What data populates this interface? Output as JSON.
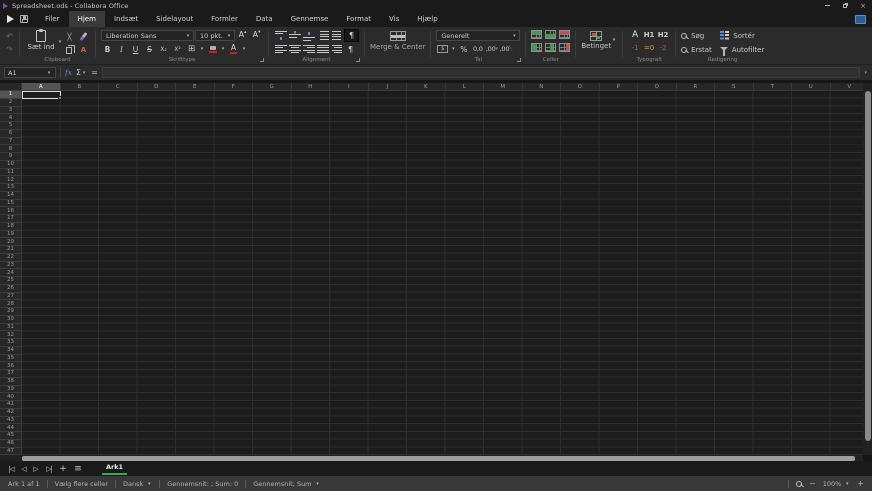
{
  "window": {
    "title": "Spreadsheet.ods - Collabora Office"
  },
  "menubar": {
    "tabs": [
      "Filer",
      "Hjem",
      "Indsæt",
      "Sidelayout",
      "Formler",
      "Data",
      "Gennemse",
      "Format",
      "Vis",
      "Hjælp"
    ],
    "active_tab": "Hjem"
  },
  "ribbon": {
    "groups": {
      "clipboard": {
        "label": "Clipboard",
        "paste": "Sæt ind"
      },
      "font": {
        "label": "Skrifttype",
        "font_name": "Liberation Sans",
        "font_size": "10 pkt.",
        "bold": "B",
        "italic": "I",
        "underline": "U",
        "strikethrough": "S",
        "subscript": "X₂",
        "superscript": "X²",
        "grow": "A",
        "shrink": "A"
      },
      "alignment": {
        "label": "Alignment"
      },
      "merge": {
        "label": "Merge & Center"
      },
      "number": {
        "label": "Tal",
        "format": "Generelt",
        "percent": "%",
        "number": "0,0",
        "add_decimal": ",00",
        "del_decimal": ",00"
      },
      "cells": {
        "label": "Celler"
      },
      "conditional": {
        "label": "Betinget"
      },
      "styles": {
        "label": "Typografi",
        "default_style": "A",
        "heading1": "H1",
        "heading2": "H2",
        "good": "-1",
        "neutral": "=0",
        "bad": "-2"
      },
      "editing": {
        "label": "Redigering",
        "search": "Søg",
        "replace": "Erstat",
        "sort": "Sortér",
        "autofilter": "Autofilter"
      }
    }
  },
  "formula_bar": {
    "cell_reference": "A1",
    "function_wizard": "fx",
    "sum": "Σ",
    "equals": "=",
    "formula": ""
  },
  "grid": {
    "columns": [
      "A",
      "B",
      "C",
      "D",
      "E",
      "F",
      "G",
      "H",
      "I",
      "J",
      "K",
      "L",
      "M",
      "N",
      "O",
      "P",
      "Q",
      "R",
      "S",
      "T",
      "U",
      "V"
    ],
    "row_count": 48,
    "selected_cell": "A1",
    "selected_column": "A",
    "selected_row": 1
  },
  "sheet_bar": {
    "tabs": [
      "Ark1"
    ],
    "active_tab": "Ark1"
  },
  "status_bar": {
    "sheet_position": "Ark 1 af 1",
    "selection_mode": "Vælg flere celler",
    "language": "Dansk",
    "stats": "Gennemsnit: ; Sum: 0",
    "stats_selector": "Gennemsnit; Sum",
    "zoom_out": "−",
    "zoom_level": "100%",
    "zoom_in": "+"
  },
  "icons": {
    "dropdown": "▾",
    "undo": "↶",
    "redo": "↷",
    "cut": "╳",
    "borders": "⊞",
    "pilcrow": "¶",
    "menu": "≡",
    "add_sheet": "+",
    "nav_first": "|◁",
    "nav_prev": "◁",
    "nav_next": "▷",
    "nav_last": "▷|",
    "close": "×",
    "currency": "$"
  },
  "colors": {
    "accent_green": "#3aa757",
    "accent_blue": "#5b8dd2",
    "logo_purple": "#7b52a1",
    "titlebar_bg": "#1a1a1a",
    "ribbon_bg": "#2b2b2b",
    "grid_bg": "#1c1c1c",
    "statusbar_bg": "#393939",
    "danger_red": "#c0504d",
    "insert_green": "#3f9e4c"
  }
}
